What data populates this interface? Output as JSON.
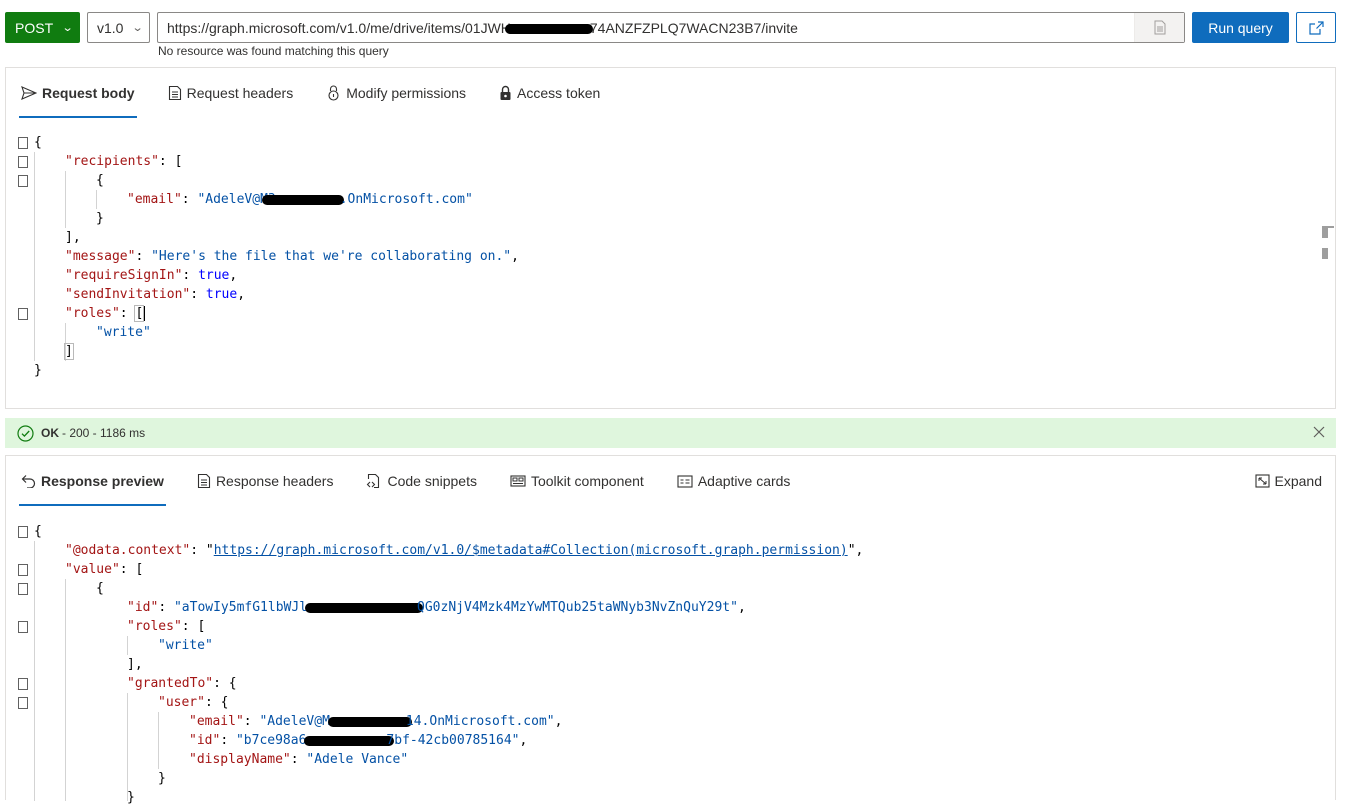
{
  "toolbar": {
    "method": "POST",
    "version": "v1.0",
    "url_prefix": "https://graph.microsoft.com/v1.0/me/drive/items/01JWH",
    "url_suffix": "74ANZFZPLQ7WACN23B7/invite",
    "url_hint": "No resource was found matching this query",
    "run_label": "Run query",
    "share_icon": "share-icon",
    "doc_icon": "document-icon"
  },
  "request": {
    "tabs": [
      {
        "label": "Request body",
        "icon": "send-icon",
        "active": true
      },
      {
        "label": "Request headers",
        "icon": "document-list-icon",
        "active": false
      },
      {
        "label": "Modify permissions",
        "icon": "lock-shield-icon",
        "active": false
      },
      {
        "label": "Access token",
        "icon": "lock-icon",
        "active": false
      }
    ],
    "body": {
      "recipients_key": "\"recipients\"",
      "email_key": "\"email\"",
      "email_start": "\"AdeleV@M3",
      "email_end": ".OnMicrosoft.com\"",
      "message_key": "\"message\"",
      "message_value": "\"Here's the file that we're collaborating on.\"",
      "require_key": "\"requireSignIn\"",
      "require_value": "true",
      "send_key": "\"sendInvitation\"",
      "send_value": "true",
      "roles_key": "\"roles\"",
      "role_value": "\"write\""
    }
  },
  "status": {
    "text_bold": "OK",
    "text_rest": "- 200 - 1186 ms",
    "icon": "checkmark-circle-icon",
    "color": "#dff6dd"
  },
  "response": {
    "tabs": [
      {
        "label": "Response preview",
        "icon": "undo-arrow-icon",
        "active": true
      },
      {
        "label": "Response headers",
        "icon": "document-list-icon",
        "active": false
      },
      {
        "label": "Code snippets",
        "icon": "code-document-icon",
        "active": false
      },
      {
        "label": "Toolkit component",
        "icon": "toolkit-icon",
        "active": false
      },
      {
        "label": "Adaptive cards",
        "icon": "card-icon",
        "active": false
      }
    ],
    "expand_label": "Expand",
    "body": {
      "context_key": "\"@odata.context\"",
      "context_value": "https://graph.microsoft.com/v1.0/$metadata#Collection(microsoft.graph.permission)",
      "value_key": "\"value\"",
      "id_key": "\"id\"",
      "id_start": "\"aTowIy5mfG1lbWJl",
      "id_end": "QG0zNjV4Mzk4MzYwMTQub25taWNyb3NvZnQuY29t\"",
      "roles_key": "\"roles\"",
      "role_value": "\"write\"",
      "granted_key": "\"grantedTo\"",
      "user_key": "\"user\"",
      "email_key": "\"email\"",
      "email_start": "\"AdeleV@M",
      "email_end": "14.OnMicrosoft.com\"",
      "uid_key": "\"id\"",
      "uid_start": "\"b7ce98a6",
      "uid_end": "7bf-42cb00785164\"",
      "display_key": "\"displayName\"",
      "display_value": "\"Adele Vance\""
    }
  },
  "colors": {
    "accent": "#0f6cbd",
    "method": "#107c10",
    "json_key": "#a31515",
    "json_string": "#0451a5",
    "json_bool": "#0000ff"
  }
}
